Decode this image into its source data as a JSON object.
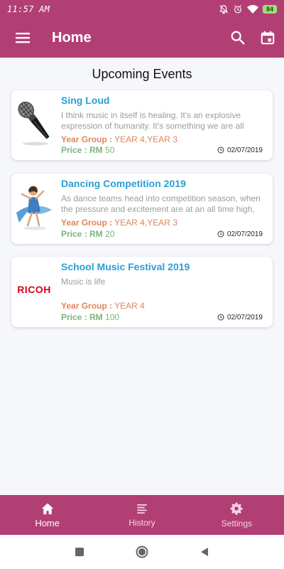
{
  "status_bar": {
    "time": "11:57 AM",
    "battery": "84",
    "icons": [
      "mute-icon",
      "alarm-icon",
      "wifi-icon",
      "battery-icon"
    ]
  },
  "app_bar": {
    "title": "Home",
    "icons": [
      "menu-icon",
      "search-icon",
      "calendar-icon"
    ]
  },
  "section_title": "Upcoming Events",
  "events": [
    {
      "title": "Sing Loud",
      "description": "I think music in itself is healing. It's an explosive expression of humanity. It's something we are all",
      "year_label": "Year Group :",
      "year_value": "YEAR 4,YEAR 3",
      "price_label": "Price : RM",
      "price_value": "50",
      "date": "02/07/2019",
      "image": "microphone-image"
    },
    {
      "title": "Dancing Competition 2019",
      "description": "As dance teams head into competition season, when the pressure and excitement are at an all time high,",
      "year_label": "Year Group :",
      "year_value": "YEAR 4,YEAR 3",
      "price_label": "Price : RM",
      "price_value": "20",
      "date": "02/07/2019",
      "image": "dancer-image"
    },
    {
      "title": "School Music Festival 2019",
      "description": "Music is life",
      "year_label": "Year Group :",
      "year_value": "YEAR 4",
      "price_label": "Price : RM",
      "price_value": "100",
      "date": "02/07/2019",
      "image": "ricoh-logo",
      "logo_text": "RICOH"
    }
  ],
  "bottom_nav": [
    {
      "label": "Home",
      "icon": "home-icon",
      "active": true
    },
    {
      "label": "History",
      "icon": "history-icon",
      "active": false
    },
    {
      "label": "Settings",
      "icon": "gear-icon",
      "active": false
    }
  ],
  "colors": {
    "primary": "#b23f73",
    "title_blue": "#2a9fd3",
    "year_orange": "#e0855a",
    "price_green": "#7ab57a",
    "desc_gray": "#9c9c9c"
  }
}
